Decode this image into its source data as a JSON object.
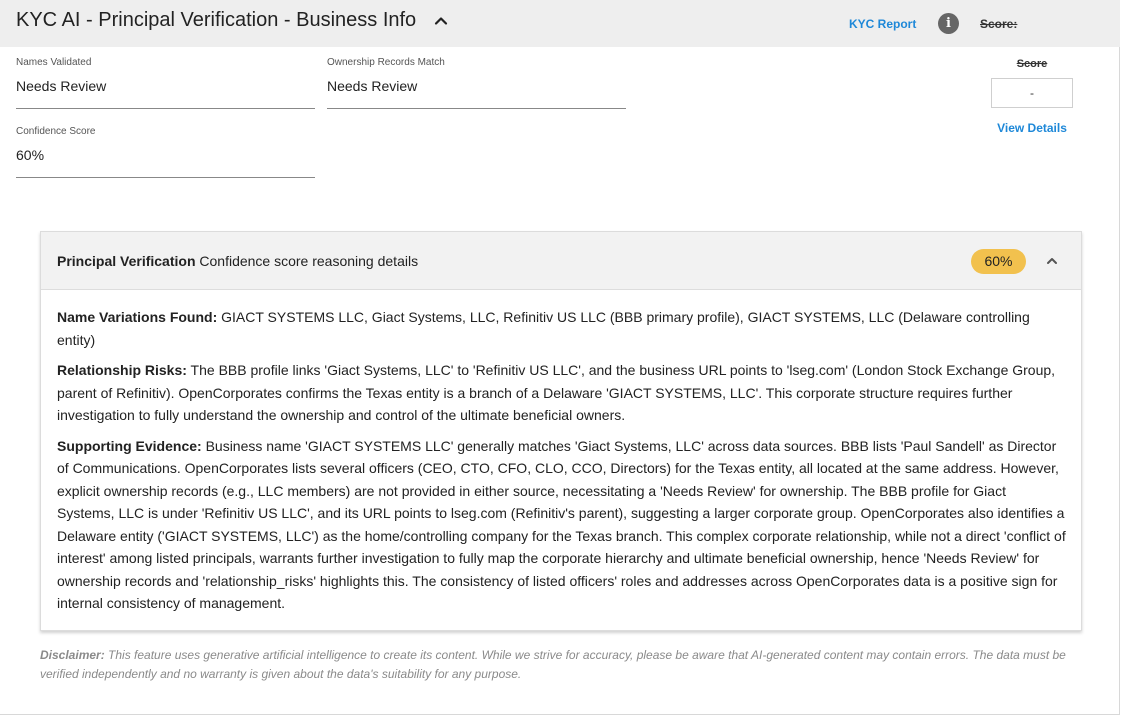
{
  "header": {
    "title": "KYC AI - Principal Verification - Business Info",
    "kyc_report_link": "KYC Report",
    "info_icon_glyph": "i",
    "score_label": "Score:"
  },
  "fields": {
    "names_validated": {
      "label": "Names Validated",
      "value": "Needs Review"
    },
    "ownership_records": {
      "label": "Ownership Records Match",
      "value": "Needs Review"
    },
    "confidence_score": {
      "label": "Confidence Score",
      "value": "60%"
    }
  },
  "score_panel": {
    "label": "Score",
    "value": "-",
    "view_details": "View Details"
  },
  "panel": {
    "title_bold": "Principal Verification",
    "title_rest": " Confidence score reasoning details",
    "badge": "60%",
    "badge_color": "#f2c14e",
    "sections": [
      {
        "heading": "Name Variations Found:",
        "text": " GIACT SYSTEMS LLC, Giact Systems, LLC, Refinitiv US LLC (BBB primary profile), GIACT SYSTEMS, LLC (Delaware controlling entity)"
      },
      {
        "heading": "Relationship Risks:",
        "text": " The BBB profile links 'Giact Systems, LLC' to 'Refinitiv US LLC', and the business URL points to 'lseg.com' (London Stock Exchange Group, parent of Refinitiv). OpenCorporates confirms the Texas entity is a branch of a Delaware 'GIACT SYSTEMS, LLC'. This corporate structure requires further investigation to fully understand the ownership and control of the ultimate beneficial owners."
      },
      {
        "heading": "Supporting Evidence:",
        "text": " Business name 'GIACT SYSTEMS LLC' generally matches 'Giact Systems, LLC' across data sources. BBB lists 'Paul Sandell' as Director of Communications. OpenCorporates lists several officers (CEO, CTO, CFO, CLO, CCO, Directors) for the Texas entity, all located at the same address. However, explicit ownership records (e.g., LLC members) are not provided in either source, necessitating a 'Needs Review' for ownership. The BBB profile for Giact Systems, LLC is under 'Refinitiv US LLC', and its URL points to lseg.com (Refinitiv's parent), suggesting a larger corporate group. OpenCorporates also identifies a Delaware entity ('GIACT SYSTEMS, LLC') as the home/controlling company for the Texas branch. This complex corporate relationship, while not a direct 'conflict of interest' among listed principals, warrants further investigation to fully map the corporate hierarchy and ultimate beneficial ownership, hence 'Needs Review' for ownership records and 'relationship_risks' highlights this. The consistency of listed officers' roles and addresses across OpenCorporates data is a positive sign for internal consistency of management."
      }
    ]
  },
  "disclaimer": {
    "label": "Disclaimer:",
    "text": " This feature uses generative artificial intelligence to create its content. While we strive for accuracy, please be aware that AI-generated content may contain errors. The data must be verified independently and no warranty is given about the data's suitability for any purpose."
  },
  "colors": {
    "link": "#1e88d8",
    "header_bg": "#eeeeee",
    "panel_head_bg": "#f2f2f2"
  }
}
